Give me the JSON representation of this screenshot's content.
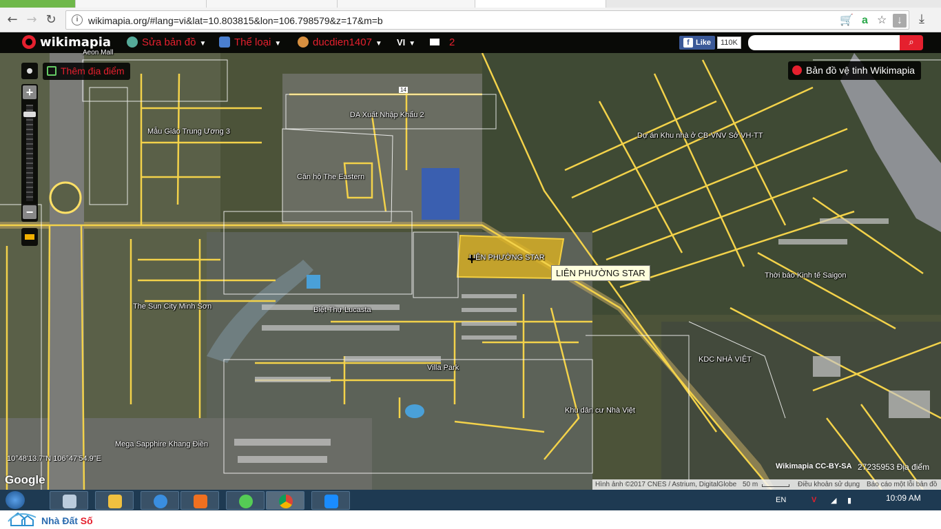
{
  "browser": {
    "url": "wikimapia.org/#lang=vi&lat=10.803815&lon=106.798579&z=17&m=b",
    "back_icon": "back-arrow-icon",
    "forward_icon": "forward-arrow-icon",
    "reload_icon": "reload-icon"
  },
  "header": {
    "logo": "wikimapia",
    "edit_map": "Sửa bản đồ",
    "categories": "Thể loại",
    "username": "ducdien1407",
    "language": "VI",
    "messages_count": "2",
    "fb_like": "Like",
    "fb_count": "110K",
    "search_placeholder": "",
    "accent_color": "#e5202e"
  },
  "controls": {
    "add_place": "Thêm địa điểm",
    "satellite_button": "Bản đồ vệ tinh Wikimapia"
  },
  "map_labels": {
    "kindergarten": "Mẫu Giáo Trung Ương 3",
    "export": "DA Xuất Nhập Khẩu 2",
    "cbvnv": "Dự án Khu nhà ở CB-VNV Sở VH-TT",
    "eastern": "Căn hộ The Eastern",
    "lien_phuong": "LIÊN PHƯỜNG STAR",
    "thoibao": "Thời báo Kinh tế Saigon",
    "sun_city": "The Sun City Minh Sơn",
    "lucasta": "Biệt Thự Lucasta",
    "villa_park": "Villa Park",
    "kdc_nha_viet": "KDC NHÀ VIỆT",
    "khu_dan_cu": "Khu dân cư Nhà Việt",
    "mega_sapphire": "Mega Sapphire Khang Điền",
    "aeon": "Aeon Mall",
    "road_14": "14"
  },
  "tooltip": "LIÊN PHƯỜNG STAR",
  "footer": {
    "coordinates": "10°48'13.7\"N 106°47'54.9\"E",
    "google": "Google",
    "license": "Wikimapia CC-BY-SA",
    "places_count": "27235953 Địa điểm",
    "imagery": "Hình ảnh ©2017 CNES / Astrium, DigitalGlobe",
    "scale": "50 m",
    "terms": "Điều khoản sử dụng",
    "report": "Báo cáo một lỗi bản đồ"
  },
  "taskbar": {
    "lang": "EN",
    "time": "10:09 AM"
  },
  "watermark": {
    "brand_a": "Nhà Đất ",
    "brand_b": "Số"
  }
}
